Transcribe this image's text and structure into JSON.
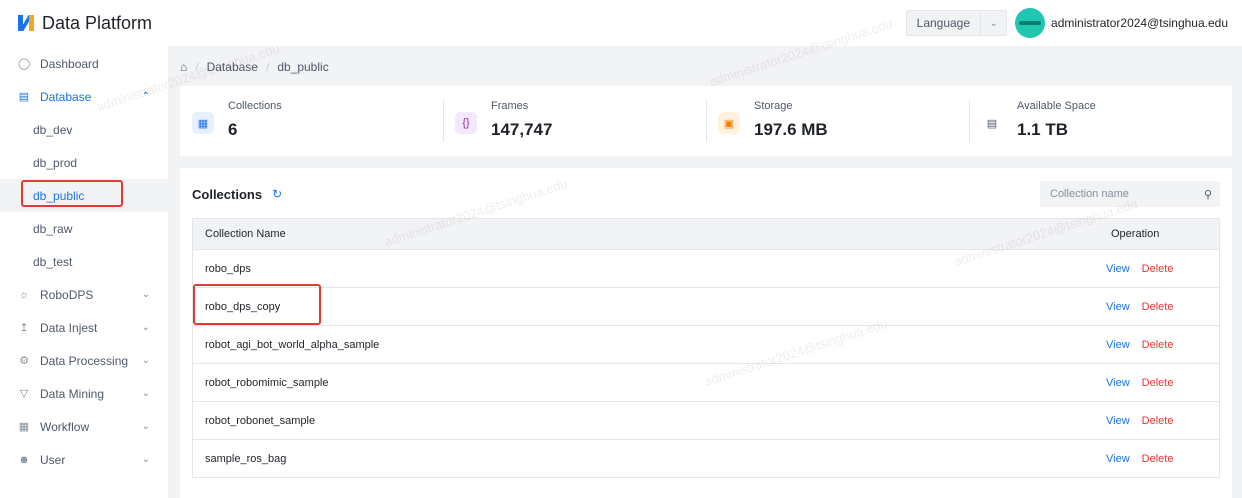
{
  "header": {
    "app_title": "Data Platform",
    "language_label": "Language",
    "user_email": "administrator2024@tsinghua.edu"
  },
  "sidebar": {
    "items": [
      {
        "label": "Dashboard",
        "icon": "dashboard-icon"
      },
      {
        "label": "Database",
        "icon": "database-icon",
        "expanded": true,
        "children": [
          "db_dev",
          "db_prod",
          "db_public",
          "db_raw",
          "db_test"
        ],
        "selected": "db_public"
      },
      {
        "label": "RoboDPS",
        "icon": "robot-icon"
      },
      {
        "label": "Data Injest",
        "icon": "upload-icon"
      },
      {
        "label": "Data Processing",
        "icon": "processing-icon"
      },
      {
        "label": "Data Mining",
        "icon": "mining-icon"
      },
      {
        "label": "Workflow",
        "icon": "workflow-icon"
      },
      {
        "label": "User",
        "icon": "user-icon"
      }
    ]
  },
  "breadcrumb": {
    "items": [
      "Database",
      "db_public"
    ]
  },
  "stats": [
    {
      "label": "Collections",
      "value": "6",
      "icon": "collections-icon"
    },
    {
      "label": "Frames",
      "value": "147,747",
      "icon": "braces-icon"
    },
    {
      "label": "Storage",
      "value": "197.6 MB",
      "icon": "storage-icon"
    },
    {
      "label": "Available Space",
      "value": "1.1 TB",
      "icon": "space-icon"
    }
  ],
  "collections": {
    "title": "Collections",
    "search_placeholder": "Collection name",
    "columns": {
      "name": "Collection Name",
      "operation": "Operation"
    },
    "view_label": "View",
    "delete_label": "Delete",
    "rows": [
      "robo_dps",
      "robo_dps_copy",
      "robot_agi_bot_world_alpha_sample",
      "robot_robomimic_sample",
      "robot_robonet_sample",
      "sample_ros_bag"
    ]
  },
  "watermark_text": "administrator2024@tsinghua.edu",
  "colors": {
    "accent": "#1a73e8",
    "danger": "#e53935",
    "highlight": "#e53935"
  }
}
